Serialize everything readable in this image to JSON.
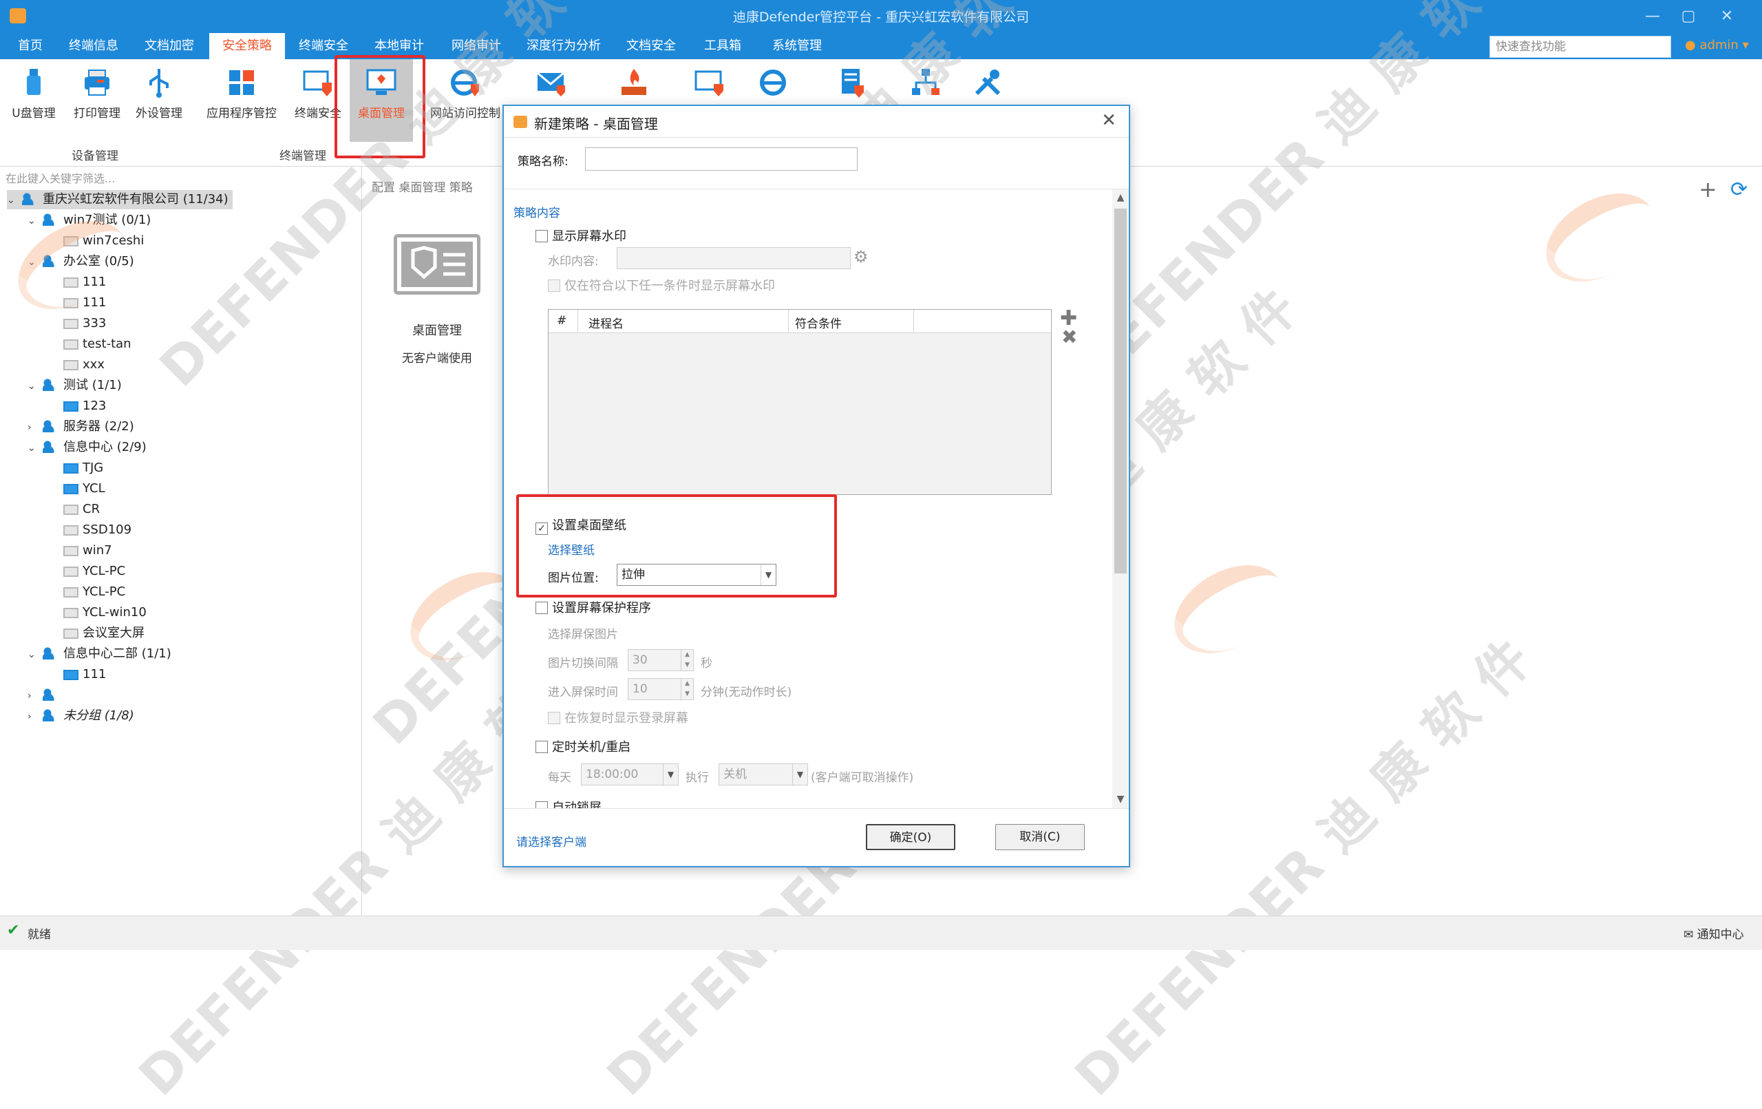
{
  "window": {
    "title": "迪康Defender管控平台 - 重庆兴虹宏软件有限公司",
    "controls": [
      "—",
      "▢",
      "✕"
    ]
  },
  "menu": {
    "items": [
      "首页",
      "终端信息",
      "文档加密",
      "安全策略",
      "终端安全",
      "本地审计",
      "网络审计",
      "深度行为分析",
      "文档安全",
      "工具箱",
      "系统管理"
    ],
    "active": "安全策略",
    "search_placeholder": "快速查找功能",
    "user": "admin"
  },
  "ribbon": {
    "buttons": [
      {
        "label": "U盘管理",
        "icon": "usb-icon"
      },
      {
        "label": "打印管理",
        "icon": "printer-icon"
      },
      {
        "label": "外设管理",
        "icon": "usb-device-icon"
      },
      {
        "label": "应用程序管控",
        "icon": "apps-icon"
      },
      {
        "label": "终端安全",
        "icon": "monitor-shield-icon"
      },
      {
        "label": "桌面管理",
        "icon": "desktop-icon"
      },
      {
        "label": "网站访问控制",
        "icon": "ie-icon"
      },
      {
        "label": "",
        "icon": "mail-shield-icon"
      },
      {
        "label": "",
        "icon": "firewall-icon"
      },
      {
        "label": "",
        "icon": "screen-lock-icon"
      },
      {
        "label": "",
        "icon": "ie-shield-icon"
      },
      {
        "label": "",
        "icon": "document-shield-icon"
      },
      {
        "label": "",
        "icon": "network-icon"
      },
      {
        "label": "",
        "icon": "tools-icon"
      }
    ],
    "groups": [
      "设备管理",
      "终端管理"
    ],
    "selected": "桌面管理"
  },
  "tree": {
    "filter_placeholder": "在此键入关键字筛选...",
    "rows": [
      {
        "text": "重庆兴虹宏软件有限公司 (11/34)",
        "level": 0,
        "type": "group",
        "arrow": "⌄"
      },
      {
        "text": "win7测试 (0/1)",
        "level": 1,
        "type": "group",
        "arrow": "⌄"
      },
      {
        "text": "win7ceshi",
        "level": 2,
        "type": "pc-off",
        "arrow": ""
      },
      {
        "text": "办公室 (0/5)",
        "level": 1,
        "type": "group",
        "arrow": "⌄"
      },
      {
        "text": "111",
        "level": 2,
        "type": "pc-off",
        "arrow": ""
      },
      {
        "text": "111",
        "level": 2,
        "type": "pc-off",
        "arrow": ""
      },
      {
        "text": "333",
        "level": 2,
        "type": "pc-off",
        "arrow": ""
      },
      {
        "text": "test-tan",
        "level": 2,
        "type": "pc-off",
        "arrow": ""
      },
      {
        "text": "xxx",
        "level": 2,
        "type": "pc-off",
        "arrow": ""
      },
      {
        "text": "测试 (1/1)",
        "level": 1,
        "type": "group",
        "arrow": "⌄"
      },
      {
        "text": "123",
        "level": 2,
        "type": "pc-on",
        "arrow": ""
      },
      {
        "text": "服务器 (2/2)",
        "level": 1,
        "type": "group",
        "arrow": "›"
      },
      {
        "text": "信息中心 (2/9)",
        "level": 1,
        "type": "group",
        "arrow": "⌄"
      },
      {
        "text": "TJG",
        "level": 2,
        "type": "pc-on",
        "arrow": ""
      },
      {
        "text": "YCL",
        "level": 2,
        "type": "pc-on",
        "arrow": ""
      },
      {
        "text": "CR",
        "level": 2,
        "type": "pc-off",
        "arrow": ""
      },
      {
        "text": "SSD109",
        "level": 2,
        "type": "pc-off",
        "arrow": ""
      },
      {
        "text": "win7",
        "level": 2,
        "type": "pc-off",
        "arrow": ""
      },
      {
        "text": "YCL-PC",
        "level": 2,
        "type": "pc-off",
        "arrow": ""
      },
      {
        "text": "YCL-PC",
        "level": 2,
        "type": "pc-off",
        "arrow": ""
      },
      {
        "text": "YCL-win10",
        "level": 2,
        "type": "pc-off",
        "arrow": ""
      },
      {
        "text": "会议室大屏",
        "level": 2,
        "type": "pc-off",
        "arrow": ""
      },
      {
        "text": "信息中心二部 (1/1)",
        "level": 1,
        "type": "group",
        "arrow": "⌄"
      },
      {
        "text": "111",
        "level": 2,
        "type": "pc-on",
        "arrow": ""
      },
      {
        "text": "",
        "level": 1,
        "type": "group",
        "arrow": "›"
      },
      {
        "text": "未分组 (1/8)",
        "level": 1,
        "type": "group",
        "arrow": "›"
      }
    ]
  },
  "center": {
    "breadcrumb": "配置 桌面管理 策略",
    "card_title": "桌面管理",
    "card_sub": "无客户端使用"
  },
  "dialog": {
    "title": "新建策略 - 桌面管理",
    "name_label": "策略名称:",
    "name_value": "",
    "section": "策略内容",
    "watermark_chk": "显示屏幕水印",
    "watermark_content_lbl": "水印内容:",
    "watermark_cond_chk": "仅在符合以下任一条件时显示屏幕水印",
    "table_headers": [
      "#",
      "进程名",
      "符合条件"
    ],
    "wallpaper_chk": "设置桌面壁纸",
    "wallpaper_checked": true,
    "choose_wallpaper": "选择壁纸",
    "pic_pos_lbl": "图片位置:",
    "pic_pos_value": "拉伸",
    "screensaver_chk": "设置屏幕保护程序",
    "choose_ss_pic": "选择屏保图片",
    "switch_interval_lbl": "图片切换间隔",
    "switch_interval_val": "30",
    "switch_interval_unit": "秒",
    "enter_time_lbl": "进入屏保时间",
    "enter_time_val": "10",
    "enter_time_unit": "分钟(无动作时长)",
    "show_login_chk": "在恢复时显示登录屏幕",
    "shutdown_chk": "定时关机/重启",
    "daily_lbl": "每天",
    "daily_time": "18:00:00",
    "exec_lbl": "执行",
    "exec_value": "关机",
    "exec_note": "(客户端可取消操作)",
    "autolock_chk": "自动锁屏",
    "choose_client": "请选择客户端",
    "ok": "确定(O)",
    "cancel": "取消(C)"
  },
  "statusbar": {
    "status": "就绪",
    "notify": "通知中心"
  },
  "watermark_text": "DEFENDER 迪 康 软 件"
}
